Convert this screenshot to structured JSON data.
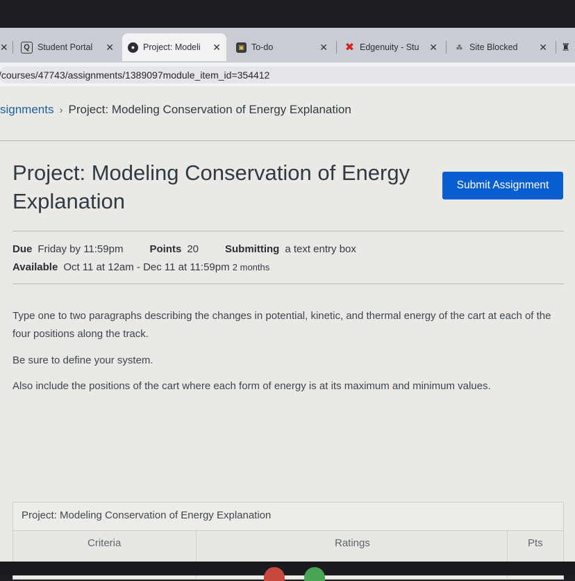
{
  "browser": {
    "tabs": [
      {
        "title": "Student Portal",
        "icon": "q-logo-icon"
      },
      {
        "title": "Project: Modeli",
        "icon": "canvas-logo-icon"
      },
      {
        "title": "To-do",
        "icon": "todo-icon"
      },
      {
        "title": "Edgenuity - Stu",
        "icon": "edgenuity-x-icon"
      },
      {
        "title": "Site Blocked",
        "icon": "site-blocked-icon"
      }
    ],
    "url": "/courses/47743/assignments/1389097module_item_id=354412"
  },
  "breadcrumb": {
    "parent": "signments",
    "current": "Project: Modeling Conservation of Energy Explanation"
  },
  "assignment": {
    "title": "Project: Modeling Conservation of Energy Explanation",
    "submit_label": "Submit Assignment",
    "due_label": "Due",
    "due_value": "Friday by 11:59pm",
    "points_label": "Points",
    "points_value": "20",
    "submitting_label": "Submitting",
    "submitting_value": "a text entry box",
    "available_label": "Available",
    "available_value": "Oct 11 at 12am - Dec 11 at 11:59pm",
    "available_duration": "2 months"
  },
  "description": [
    "Type one to two paragraphs describing the changes in potential, kinetic, and thermal energy of the cart at each of the four positions along the track.",
    "Be sure to define your system.",
    "Also include the positions of the cart where each form of energy is at its maximum and minimum values."
  ],
  "rubric": {
    "title": "Project: Modeling Conservation of Energy Explanation",
    "columns": [
      "Criteria",
      "Ratings",
      "Pts"
    ]
  },
  "colors": {
    "accent": "#0a5fd0",
    "link": "#1a5fa0"
  }
}
